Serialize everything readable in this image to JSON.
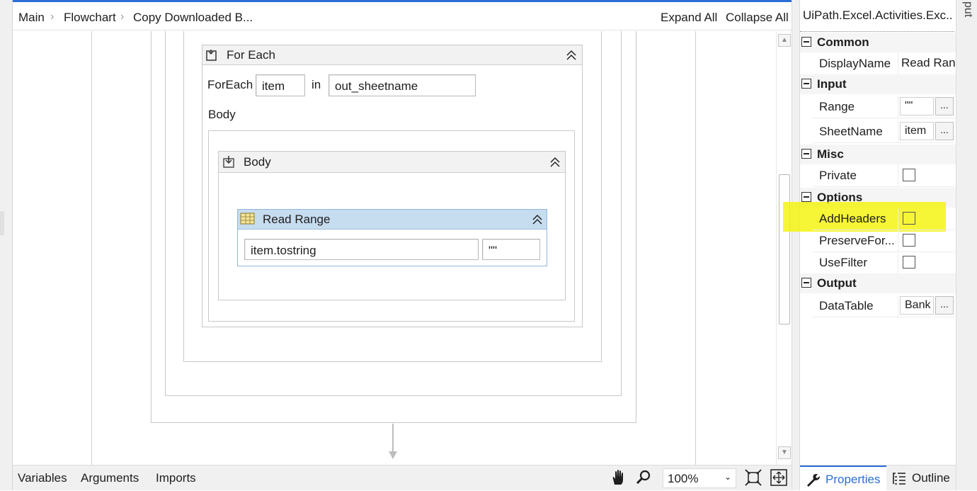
{
  "breadcrumb": {
    "items": [
      "Main",
      "Flowchart",
      "Copy Downloaded B..."
    ],
    "separator": "›",
    "expand_all": "Expand All",
    "collapse_all": "Collapse All"
  },
  "foreach": {
    "title": "For Each",
    "foreach_label": "ForEach",
    "item_value": "item",
    "in_label": "in",
    "collection_value": "out_sheetname",
    "body_label": "Body"
  },
  "sequence": {
    "title": "Body"
  },
  "read_range": {
    "title": "Read Range",
    "sheet_value": "item.tostring",
    "range_value": "\"\""
  },
  "bottom": {
    "tabs": [
      "Variables",
      "Arguments",
      "Imports"
    ],
    "zoom": "100%"
  },
  "properties": {
    "title": "UiPath.Excel.Activities.Exc...",
    "categories": {
      "common": "Common",
      "input": "Input",
      "misc": "Misc",
      "options": "Options",
      "output": "Output"
    },
    "rows": {
      "display_name": {
        "label": "DisplayName",
        "value": "Read Range"
      },
      "range": {
        "label": "Range",
        "value": "\"\""
      },
      "sheet_name": {
        "label": "SheetName",
        "value": "item"
      },
      "private": {
        "label": "Private"
      },
      "add_headers": {
        "label": "AddHeaders"
      },
      "preserve_format": {
        "label": "PreserveFor..."
      },
      "use_filter": {
        "label": "UseFilter"
      },
      "data_table": {
        "label": "DataTable",
        "value": "Bank"
      }
    },
    "ellipsis": "...",
    "tabs": {
      "properties": "Properties",
      "outline": "Outline"
    }
  },
  "side_label": "put",
  "colors": {
    "accent": "#2b6fd6",
    "read_range_header": "#c6dcef",
    "highlight": "#f4f40a"
  }
}
